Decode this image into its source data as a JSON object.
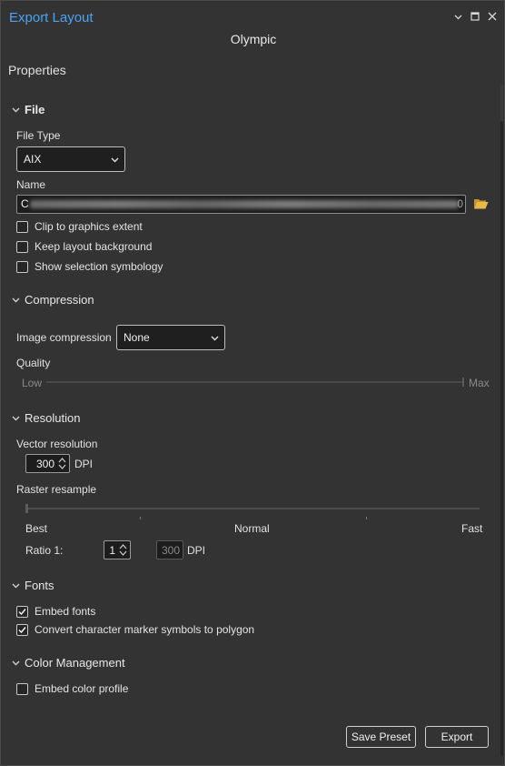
{
  "window": {
    "title": "Export Layout",
    "subtitle": "Olympic",
    "controls": [
      "chevron-down-icon",
      "maximize-icon",
      "close-icon"
    ]
  },
  "properties_label": "Properties",
  "file": {
    "section_label": "File",
    "file_type_label": "File Type",
    "file_type_value": "AIX",
    "name_label": "Name",
    "name_value_prefix": "C",
    "name_value_suffix": "0",
    "clip_label": "Clip to graphics extent",
    "clip_checked": false,
    "keep_bg_label": "Keep layout background",
    "keep_bg_checked": false,
    "show_sel_label": "Show selection symbology",
    "show_sel_checked": false
  },
  "compression": {
    "section_label": "Compression",
    "image_compression_label": "Image compression",
    "image_compression_value": "None",
    "quality_label": "Quality",
    "low_label": "Low",
    "max_label": "Max"
  },
  "resolution": {
    "section_label": "Resolution",
    "vector_label": "Vector resolution",
    "vector_value": "300",
    "dpi_label": "DPI",
    "raster_label": "Raster resample",
    "best_label": "Best",
    "normal_label": "Normal",
    "fast_label": "Fast",
    "ratio_label": "Ratio 1:",
    "ratio_value": "1",
    "raster_dpi_value": "300",
    "raster_dpi_label": "DPI"
  },
  "fonts": {
    "section_label": "Fonts",
    "embed_label": "Embed fonts",
    "embed_checked": true,
    "convert_label": "Convert character marker symbols to polygon",
    "convert_checked": true
  },
  "color_management": {
    "section_label": "Color Management",
    "embed_profile_label": "Embed color profile",
    "embed_profile_checked": false
  },
  "buttons": {
    "save_preset": "Save Preset",
    "export": "Export"
  },
  "colors": {
    "title_accent": "#4ea1f0",
    "background": "#333333",
    "folder_icon": "#e8b84a"
  }
}
